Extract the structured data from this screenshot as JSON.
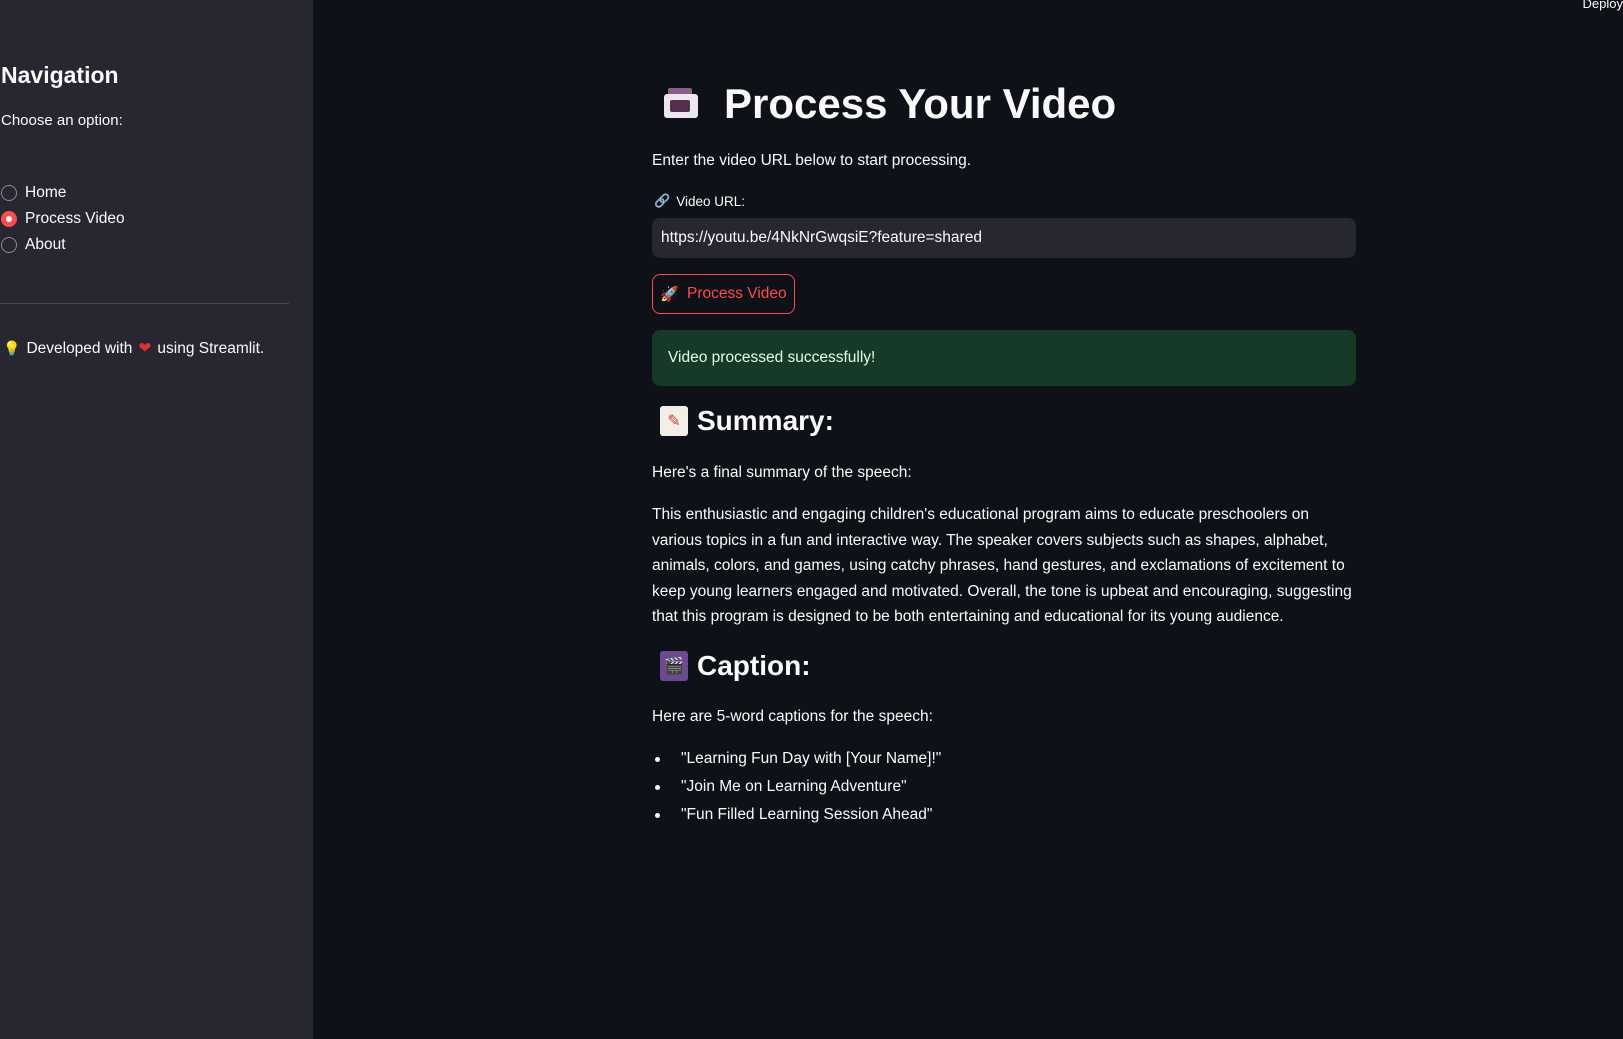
{
  "sidebar": {
    "title": "Navigation",
    "prompt": "Choose an option:",
    "options": [
      {
        "label": "Home",
        "selected": false
      },
      {
        "label": "Process Video",
        "selected": true
      },
      {
        "label": "About",
        "selected": false
      }
    ],
    "footer_prefix": "Developed with",
    "footer_suffix": "using Streamlit.",
    "footer_bulb_icon": "💡",
    "footer_heart_icon": "❤"
  },
  "header": {
    "deploy_label": "Deploy"
  },
  "main": {
    "title": "Process Your Video",
    "intro": "Enter the video URL below to start processing.",
    "url_label": "Video URL:",
    "url_value": "https://youtu.be/4NkNrGwqsiE?feature=shared",
    "link_icon": "🔗",
    "button_label": "Process Video",
    "button_icon": "🚀",
    "success_message": "Video processed successfully!",
    "summary_heading": "Summary:",
    "summary_intro": "Here's a final summary of the speech:",
    "summary_text": "This enthusiastic and engaging children's educational program aims to educate preschoolers on various topics in a fun and interactive way. The speaker covers subjects such as shapes, alphabet, animals, colors, and games, using catchy phrases, hand gestures, and exclamations of excitement to keep young learners engaged and motivated. Overall, the tone is upbeat and encouraging, suggesting that this program is designed to be both entertaining and educational for its young audience.",
    "caption_heading": "Caption:",
    "caption_intro": "Here are 5-word captions for the speech:",
    "captions": [
      "\"Learning Fun Day with [Your Name]!\"",
      "\"Join Me on Learning Adventure\"",
      "\"Fun Filled Learning Session Ahead\""
    ]
  },
  "colors": {
    "background": "#0e1117",
    "sidebar": "#262730",
    "accent": "#ff4b4b",
    "success_bg": "#173928"
  }
}
